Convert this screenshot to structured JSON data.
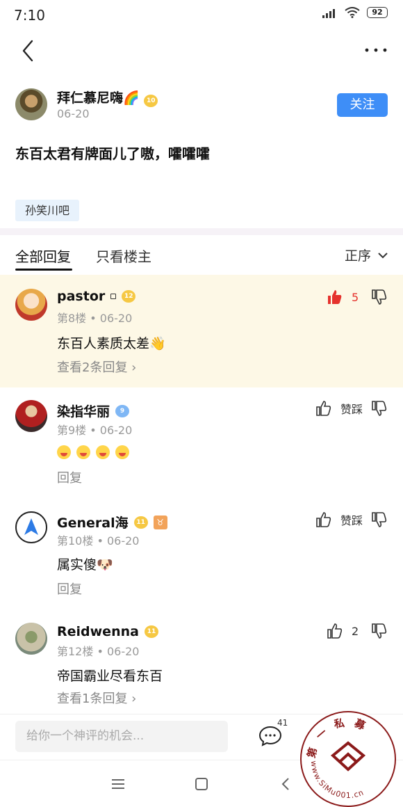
{
  "status_bar": {
    "time": "7:10",
    "battery": "92"
  },
  "post": {
    "author": "拜仁慕尼嗨🌈",
    "author_level": "10",
    "date": "06-20",
    "follow_label": "关注",
    "content": "东百太君有牌面儿了嗷，嚯嚯嚯",
    "forum_tag": "孙笑川吧"
  },
  "tabs": {
    "all": "全部回复",
    "owner_only": "只看楼主",
    "sort": "正序"
  },
  "comments": [
    {
      "name": "pastor",
      "level": "12",
      "floor": "第8楼",
      "date": "06-20",
      "text": "东百人素质太差👋",
      "reply": "查看2条回复",
      "like_count": "5",
      "liked": true
    },
    {
      "name": "染指华丽",
      "level": "9",
      "floor": "第9楼",
      "date": "06-20",
      "text": "",
      "reply": "回复",
      "like_label": "赞踩"
    },
    {
      "name": "General海",
      "level": "11",
      "zodiac": "♉",
      "floor": "第10楼",
      "date": "06-20",
      "text": "属实傻🐶",
      "reply": "回复",
      "like_label": "赞踩"
    },
    {
      "name": "Reidwenna",
      "level": "11",
      "floor": "第12楼",
      "date": "06-20",
      "text": "帝国霸业尽看东百",
      "reply": "查看1条回复",
      "like_count": "2"
    }
  ],
  "bottom": {
    "input_placeholder": "给你一个神评的机会...",
    "comment_count": "41"
  },
  "watermark": {
    "top_text": "第一私募",
    "url": "www.SiMu001.cn"
  },
  "colors": {
    "accent": "#3e8ef7",
    "like_red": "#e5322d",
    "highlight_bg": "#fdf8e6"
  }
}
